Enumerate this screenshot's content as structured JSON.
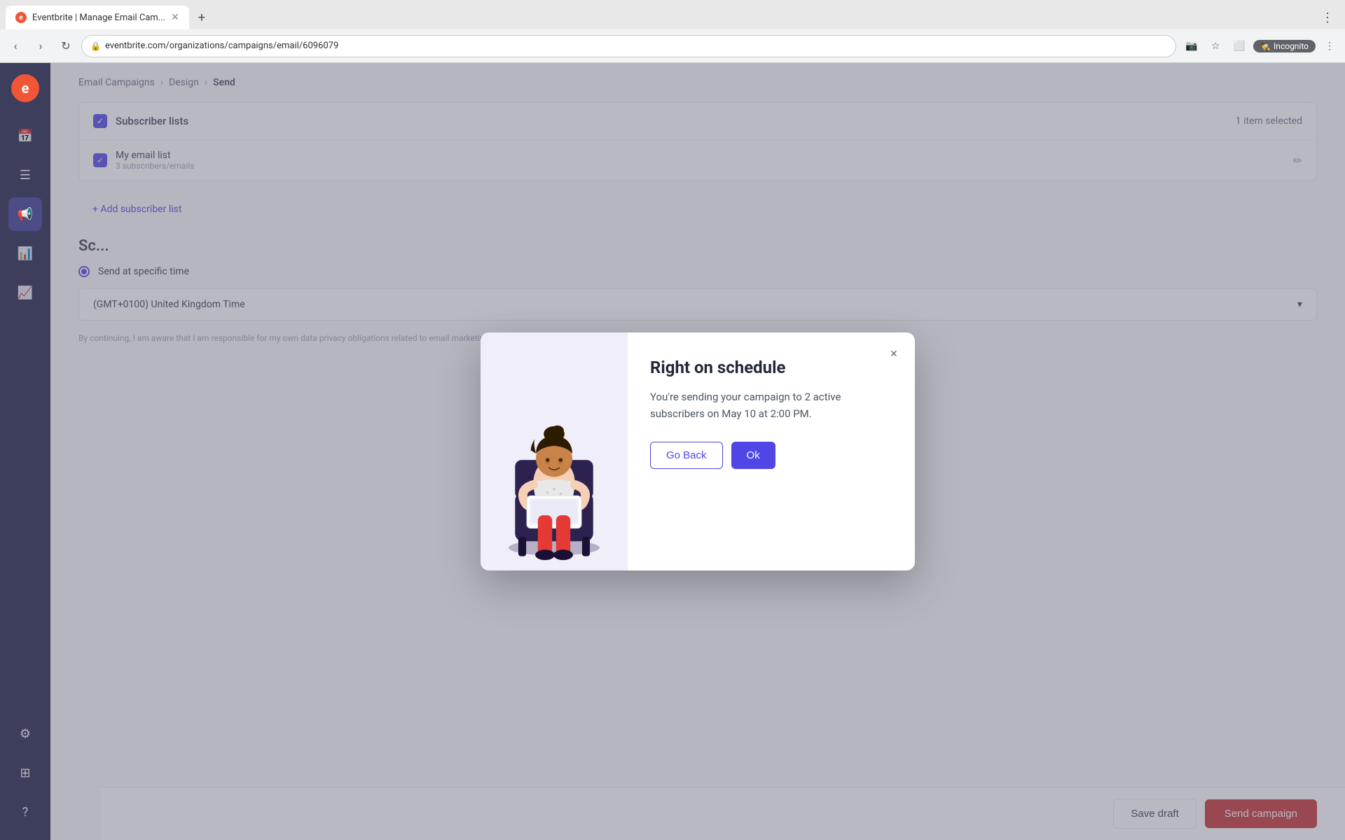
{
  "browser": {
    "tab_title": "Eventbrite | Manage Email Cam...",
    "tab_favicon": "e",
    "url": "eventbrite.com/organizations/campaigns/email/6096079",
    "incognito_label": "Incognito"
  },
  "breadcrumb": {
    "item1": "Email Campaigns",
    "item2": "Design",
    "item3": "Send"
  },
  "subscriber_section": {
    "title": "Subscriber lists",
    "count": "1 item selected",
    "list_name": "My email list",
    "list_sub": "3 subscribers/emails"
  },
  "add_list": {
    "label": "+ Add subscriber list"
  },
  "schedule": {
    "section_title": "Sc...",
    "timezone_value": "(GMT+0100) United Kingdom Time"
  },
  "disclaimer": {
    "text": "By continuing, I am aware that I am responsible for my own data privacy obligations related to email marketing, including obtaining any required opt-in consent from the recipients."
  },
  "bottom_bar": {
    "save_draft_label": "Save draft",
    "send_campaign_label": "Send campaign"
  },
  "modal": {
    "title": "Right on schedule",
    "description": "You're sending your campaign to 2 active subscribers on May 10 at 2:00 PM.",
    "go_back_label": "Go Back",
    "ok_label": "Ok",
    "close_icon": "×"
  },
  "sidebar": {
    "items": [
      {
        "name": "calendar-icon",
        "icon": "📅"
      },
      {
        "name": "list-icon",
        "icon": "☰"
      },
      {
        "name": "campaign-icon",
        "icon": "📢"
      },
      {
        "name": "chart-icon",
        "icon": "📊"
      },
      {
        "name": "analytics-icon",
        "icon": "📈"
      },
      {
        "name": "settings-icon",
        "icon": "⚙"
      },
      {
        "name": "grid-icon",
        "icon": "⊞"
      },
      {
        "name": "help-icon",
        "icon": "?"
      }
    ]
  }
}
